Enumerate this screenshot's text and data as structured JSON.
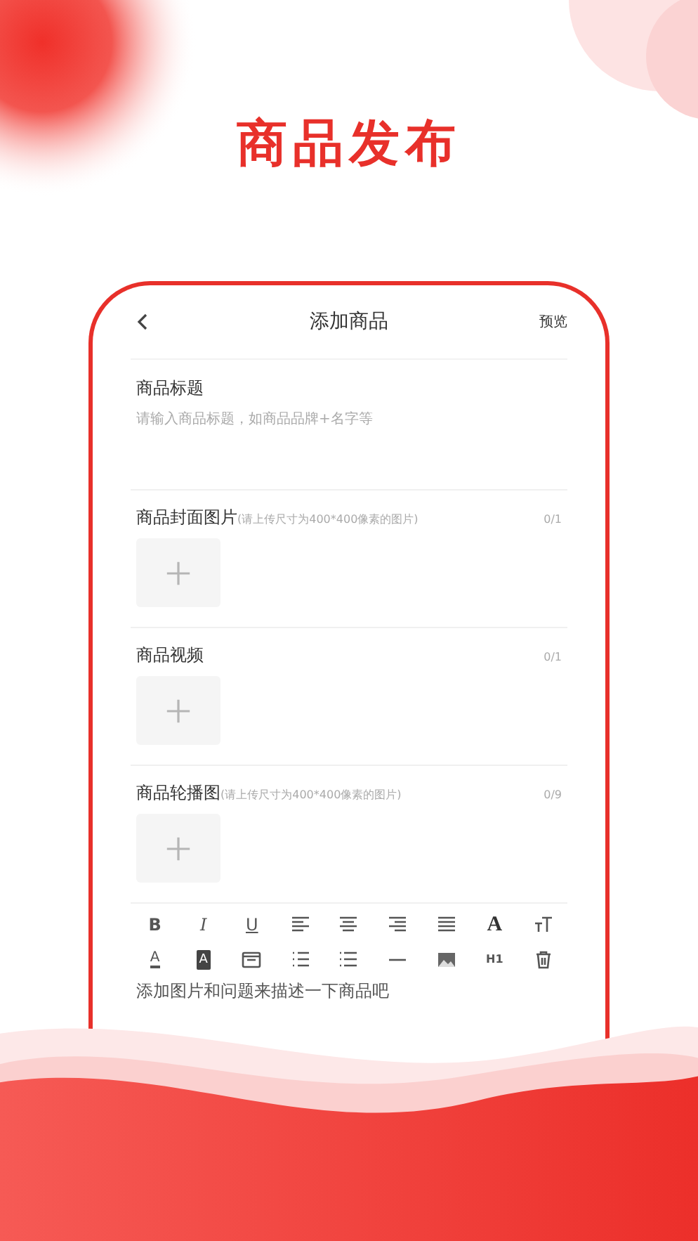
{
  "headline": "商品发布",
  "header": {
    "title": "添加商品",
    "action": "预览"
  },
  "title_field": {
    "label": "商品标题",
    "placeholder": "请输入商品标题，如商品品牌+名字等"
  },
  "uploads": [
    {
      "label": "商品封面图片",
      "hint": "(请上传尺寸为400*400像素的图片)",
      "count": "0/1"
    },
    {
      "label": "商品视频",
      "count": "0/1"
    },
    {
      "label": "商品轮播图",
      "hint": "(请上传尺寸为400*400像素的图片)",
      "count": "0/9"
    }
  ],
  "toolbar": [
    {
      "kind": "bold",
      "label": "B"
    },
    {
      "kind": "italic",
      "label": "I"
    },
    {
      "kind": "underline",
      "label": "U"
    },
    {
      "kind": "align-left"
    },
    {
      "kind": "align-center"
    },
    {
      "kind": "align-right"
    },
    {
      "kind": "justify"
    },
    {
      "kind": "serif",
      "label": "A"
    },
    {
      "kind": "text-size"
    },
    {
      "kind": "font-color",
      "label": "A"
    },
    {
      "kind": "highlight",
      "label": "A"
    },
    {
      "kind": "date"
    },
    {
      "kind": "ordered-list"
    },
    {
      "kind": "bullet-list"
    },
    {
      "kind": "rule"
    },
    {
      "kind": "image"
    },
    {
      "kind": "heading",
      "label": "H1"
    },
    {
      "kind": "trash"
    }
  ],
  "editor": {
    "placeholder": "添加图片和问题来描述一下商品吧"
  }
}
